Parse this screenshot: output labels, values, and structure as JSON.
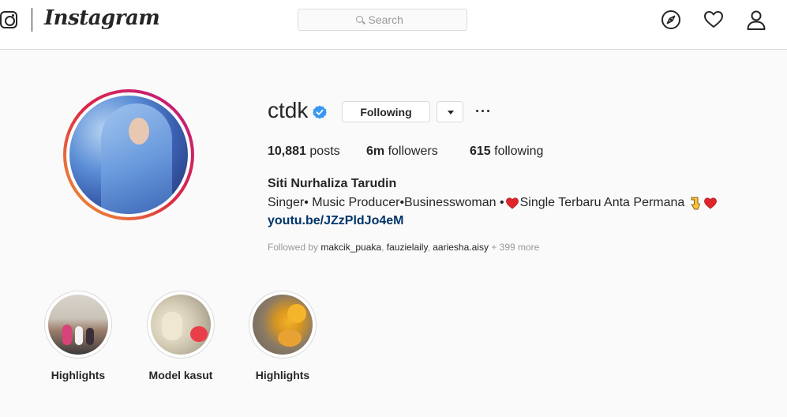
{
  "nav": {
    "brand": "Instagram",
    "search_placeholder": "Search",
    "icons": [
      "instagram-glyph-icon",
      "compass-icon",
      "heart-icon",
      "person-icon"
    ]
  },
  "profile": {
    "username": "ctdk",
    "verified": true,
    "follow_button": "Following",
    "stats": {
      "posts_count": "10,881",
      "posts_label": "posts",
      "followers_count": "6m",
      "followers_label": "followers",
      "following_count": "615",
      "following_label": "following"
    },
    "full_name": "Siti Nurhaliza Tarudin",
    "bio_part1": "Singer• Music Producer•Businesswoman •",
    "bio_part2": "Single Terbaru Anta Permana",
    "bio_link": "youtu.be/JZzPldJo4eM",
    "followed_by_prefix": "Followed by",
    "followed_by_users": [
      "makcik_puaka",
      "fauzielaily",
      "aariesha.aisy"
    ],
    "followed_by_more": "+ 399 more"
  },
  "highlights": [
    {
      "label": "Highlights"
    },
    {
      "label": "Model kasut"
    },
    {
      "label": "Highlights"
    }
  ],
  "colors": {
    "accent_link": "#003569",
    "verified_blue": "#3897f0",
    "border": "#dbdbdb",
    "muted_text": "#999999"
  }
}
